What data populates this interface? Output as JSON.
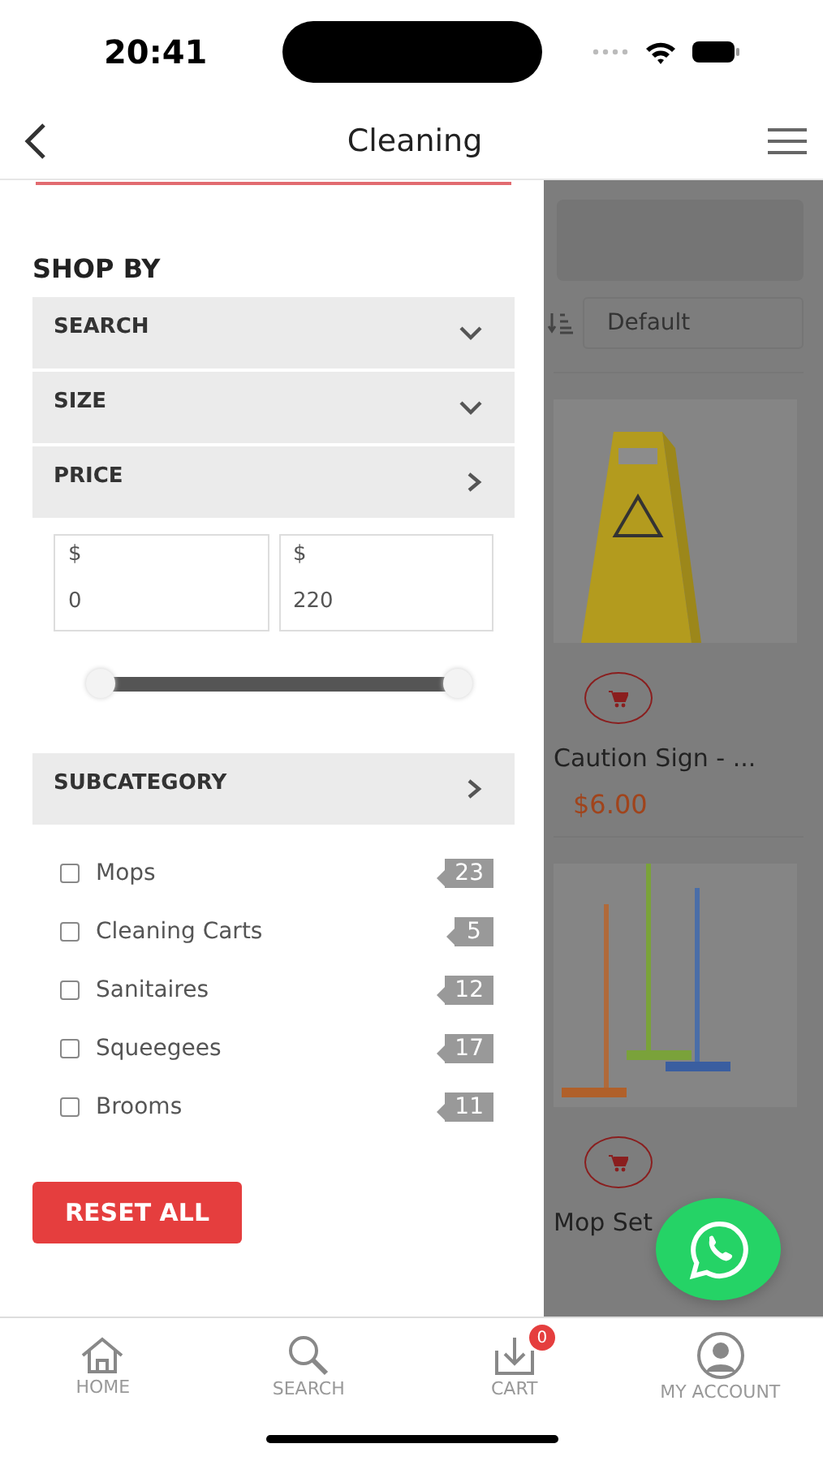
{
  "status_bar": {
    "time": "20:41"
  },
  "header": {
    "title": "Cleaning"
  },
  "filter": {
    "heading": "SHOP BY",
    "sections": [
      {
        "label": "SEARCH",
        "expanded": false
      },
      {
        "label": "SIZE",
        "expanded": false
      },
      {
        "label": "PRICE",
        "expanded": true,
        "kind": "price"
      }
    ],
    "price": {
      "min_prefix": "$",
      "min_value": "0",
      "max_prefix": "$",
      "max_value": "220",
      "slider": {
        "level": 1
      }
    },
    "subcategory": {
      "label": "SUBCATEGORY",
      "expanded": true
    },
    "subcategories": [
      {
        "name": "Mops",
        "count": "23",
        "checked": false
      },
      {
        "name": "Cleaning Carts",
        "count": "5",
        "checked": false
      },
      {
        "name": "Sanitaires",
        "count": "12",
        "checked": false
      },
      {
        "name": "Squeegees",
        "count": "17",
        "checked": false
      },
      {
        "name": "Brooms",
        "count": "11",
        "checked": false
      }
    ],
    "reset_button": "RESET ALL"
  },
  "products": {
    "sort": "Default",
    "items": [
      {
        "name": "Caution Sign - ...",
        "price": "$6.00",
        "kind": "sign"
      },
      {
        "name": "Mop Set",
        "kind": "mops"
      }
    ]
  },
  "bottom_nav": [
    {
      "label": "HOME"
    },
    {
      "label": "SEARCH"
    },
    {
      "label": "CART",
      "badge": "0"
    },
    {
      "label": "MY ACCOUNT"
    }
  ]
}
